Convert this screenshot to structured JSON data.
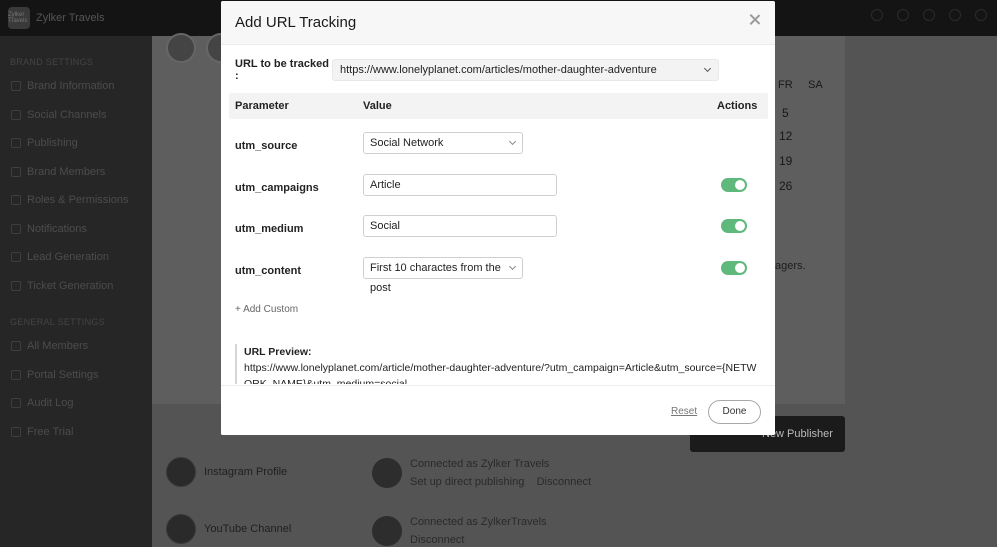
{
  "background": {
    "brand_name": "Zylker Travels",
    "logo_text": "Zylker Travels",
    "sidebar": {
      "brand_settings_label": "BRAND SETTINGS",
      "brand_items": [
        {
          "label": "Brand Information",
          "icon": "info-icon"
        },
        {
          "label": "Social Channels",
          "icon": "share-icon"
        },
        {
          "label": "Publishing",
          "icon": "send-icon"
        },
        {
          "label": "Brand Members",
          "icon": "users-icon"
        },
        {
          "label": "Roles & Permissions",
          "icon": "key-icon"
        },
        {
          "label": "Notifications",
          "icon": "bell-icon"
        },
        {
          "label": "Lead Generation",
          "icon": "funnel-icon"
        },
        {
          "label": "Ticket Generation",
          "icon": "ticket-icon"
        }
      ],
      "general_settings_label": "GENERAL SETTINGS",
      "general_items": [
        {
          "label": "All Members",
          "icon": "users-icon"
        },
        {
          "label": "Portal Settings",
          "icon": "gear-icon"
        },
        {
          "label": "Audit Log",
          "icon": "log-icon"
        },
        {
          "label": "Free Trial",
          "icon": "gift-icon"
        }
      ]
    },
    "calendar": {
      "day_fr": "FR",
      "day_sa": "SA",
      "dates": [
        "5",
        "12",
        "19",
        "26"
      ]
    },
    "managers_text": "agers.",
    "new_publisher_label": "New Publisher",
    "instagram_label": "Instagram Profile",
    "youtube_label": "YouTube Channel",
    "connected_as_1": "Connected as Zylker Travels",
    "direct_publishing": "Set up direct publishing",
    "disconnect_1": "Disconnect",
    "connected_as_2": "Connected as ZylkerTravels",
    "disconnect_2": "Disconnect"
  },
  "modal": {
    "title": "Add URL Tracking",
    "url_label": "URL to be tracked :",
    "url_value": "https://www.lonelyplanet.com/articles/mother-daughter-adventure",
    "table_headers": {
      "parameter": "Parameter",
      "value": "Value",
      "actions": "Actions"
    },
    "params": [
      {
        "name": "utm_source",
        "value": "Social Network",
        "control": "select",
        "toggle": null
      },
      {
        "name": "utm_campaigns",
        "value": "Article",
        "control": "input",
        "toggle": true
      },
      {
        "name": "utm_medium",
        "value": "Social",
        "control": "input",
        "toggle": true
      },
      {
        "name": "utm_content",
        "value": "First 10 charactes from the post",
        "control": "select",
        "toggle": true
      }
    ],
    "add_custom": "+ Add Custom",
    "preview_label": "URL Preview:",
    "preview_url": "https://www.lonelyplanet.com/article/mother-daughter-adventure/?utm_campaign=Article&utm_source={NETWORK_NAME}&utm_medium=social",
    "reset_label": "Reset",
    "done_label": "Done",
    "toggle_on_color": "#5fb87c"
  }
}
